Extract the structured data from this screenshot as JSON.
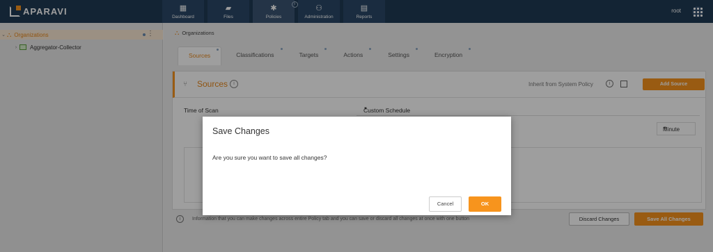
{
  "app": {
    "logo": "APARAVI",
    "user": "root"
  },
  "nav": [
    {
      "label": "Dashboard",
      "icon": "dashboard-icon"
    },
    {
      "label": "Files",
      "icon": "folder-icon"
    },
    {
      "label": "Policies",
      "icon": "gear-icon"
    },
    {
      "label": "Administration",
      "icon": "users-icon"
    },
    {
      "label": "Reports",
      "icon": "report-icon"
    }
  ],
  "tree": {
    "root": "Organizations",
    "child": "Aggregator-Collector"
  },
  "breadcrumb": "Organizations",
  "tabs": [
    "Sources",
    "Classifications",
    "Targets",
    "Actions",
    "Settings",
    "Encryption"
  ],
  "panel": {
    "title": "Sources",
    "inherit_label": "Inherit from System Policy",
    "add_source": "Add Source",
    "time_of_scan_label": "Time of Scan",
    "time_of_scan_value": "Custom Schedule",
    "interval_unit": "Minute"
  },
  "footer": {
    "info_text": "Information that you can make changes across entire Policy tab and you can save or discard all changes at once with one button",
    "discard": "Discard Changes",
    "save_all": "Save All Changes"
  },
  "modal": {
    "title": "Save Changes",
    "message": "Are you sure you want to save all changes?",
    "cancel": "Cancel",
    "ok": "OK"
  },
  "colors": {
    "accent": "#f7941d",
    "topbar": "#1f3a55"
  }
}
